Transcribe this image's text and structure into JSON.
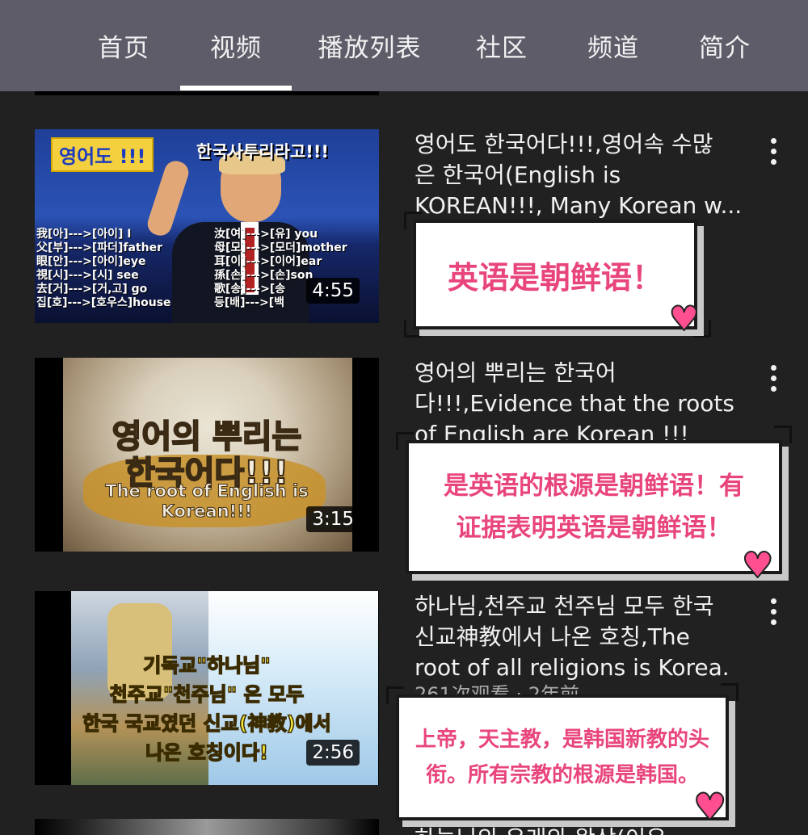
{
  "tabs": [
    {
      "label": "首页"
    },
    {
      "label": "视频"
    },
    {
      "label": "播放列表"
    },
    {
      "label": "社区"
    },
    {
      "label": "频道"
    },
    {
      "label": "简介"
    }
  ],
  "active_tab": "视频",
  "videos": [
    {
      "duration": "4:55",
      "title_lines": [
        "영어도 한국어다!!!,영어속 수많",
        "은 한국어(English is",
        "KOREAN!!!, Many Korean w..."
      ],
      "caption": [
        "英语是朝鲜语！"
      ],
      "thumb_text": {
        "badge": "영어도 !!!",
        "headline": "한국사투리라고!!!",
        "rows_left": [
          "我[아]--->[아이]  I",
          "父[부]--->[파더]father",
          "眼[안]--->[아이]eye",
          "視[시]--->[시] see",
          "去[거]--->[거,고] go",
          "집[호]--->[호우스]house"
        ],
        "rows_right": [
          "汝[여]--->[유] you",
          "母[모]--->[모더]mother",
          "耳[이]--->[이어]ear",
          "孫[손]--->[손]son",
          "歌[송]--->[송",
          "등[배]--->[백"
        ]
      }
    },
    {
      "duration": "3:15",
      "title_lines": [
        "영어의 뿌리는 한국어",
        "다!!!,Evidence that the roots",
        "of English are Korean !!!"
      ],
      "caption": [
        "是英语的根源是朝鲜语！有",
        "证据表明英语是朝鲜语！"
      ],
      "thumb_text": {
        "line1": "영어의 뿌리는",
        "line2": "한국어다!!!",
        "line3": "The root of English is",
        "line4": "Korean!!!"
      }
    },
    {
      "duration": "2:56",
      "title_lines": [
        "하나님,천주교 천주님 모두 한국",
        "신교神教에서 나온 호칭,The",
        "root of all religions is Korea."
      ],
      "meta": "261次观看 · 2年前",
      "caption": [
        "上帝，天主教，是韩国新教的头",
        "衔。所有宗教的根源是韩国。"
      ],
      "thumb_text": {
        "line1": "기독교\"하나님\"",
        "line2": "천주교\"천주님\" 은 모두",
        "line3": "한국 국교였던 신교(神教)에서",
        "line4": "나온 호칭이다!"
      }
    }
  ],
  "partial_title": "하늘님의 유래와 왕상(이유"
}
